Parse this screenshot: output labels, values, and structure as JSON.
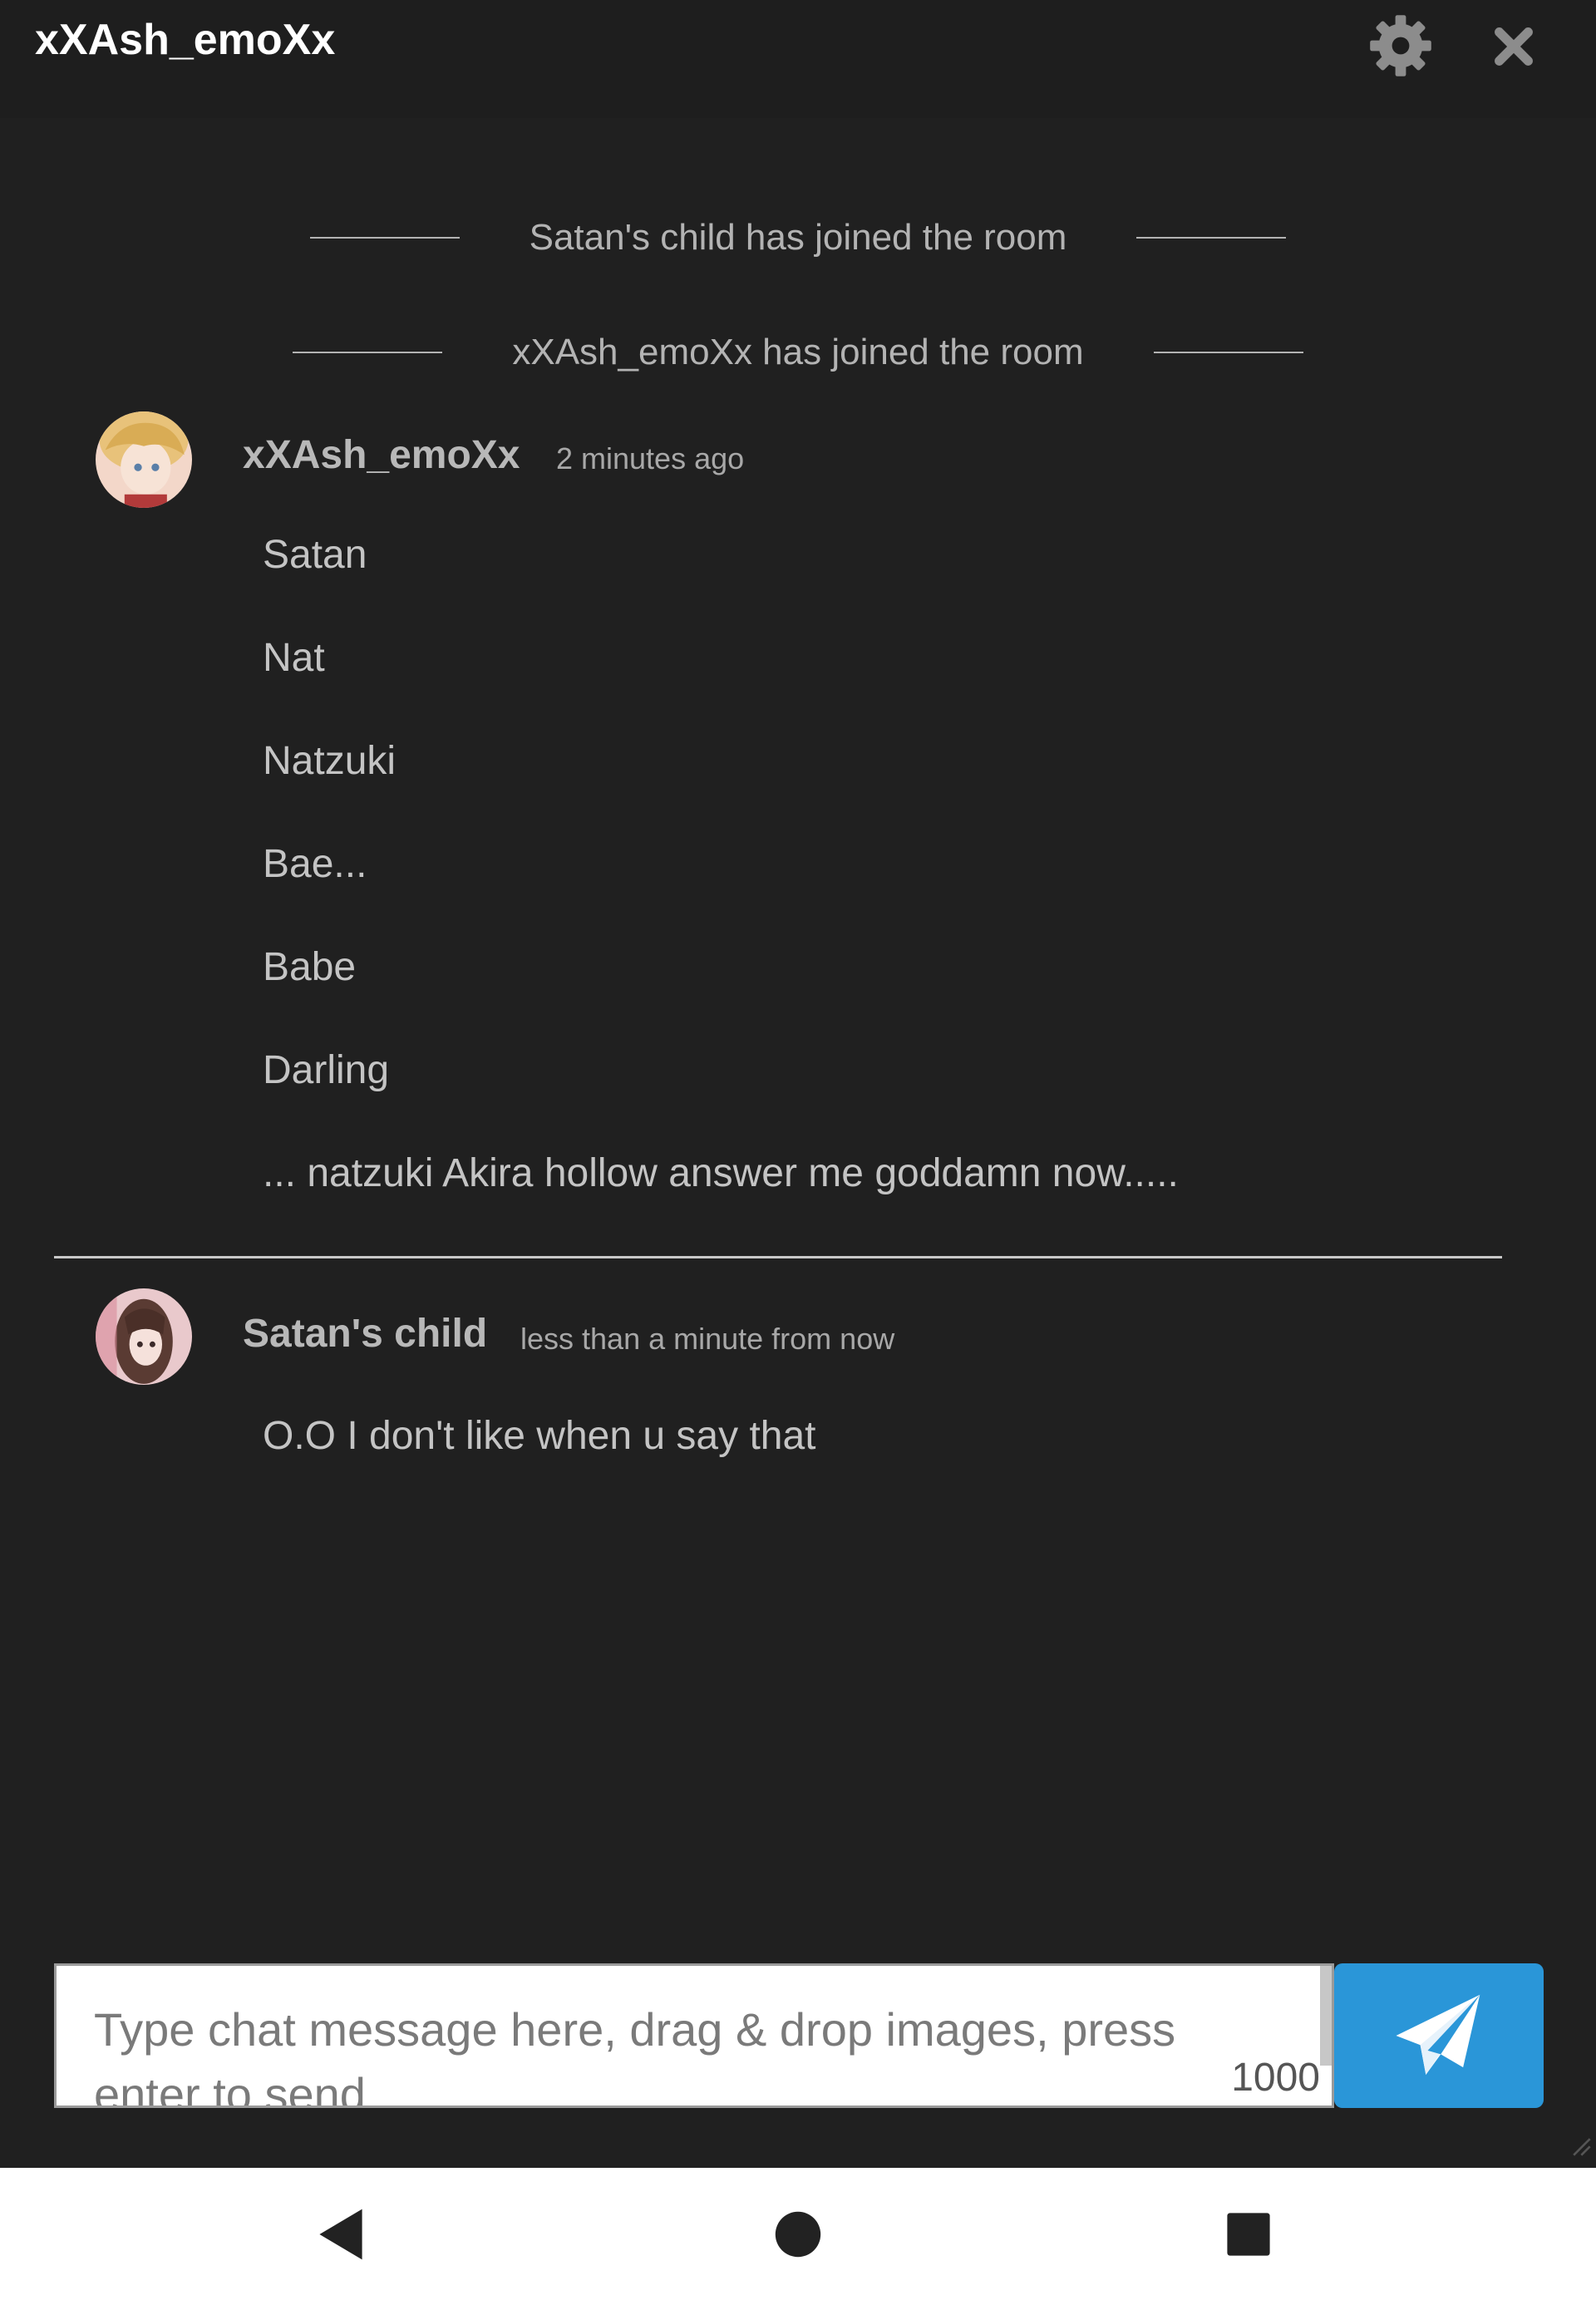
{
  "header": {
    "title": "xXAsh_emoXx",
    "settings_icon": "gear-icon",
    "close_icon": "close-icon"
  },
  "system_messages": [
    {
      "text": "Satan's child has joined the room"
    },
    {
      "text": "xXAsh_emoXx has joined the room"
    }
  ],
  "messages": [
    {
      "author": "xXAsh_emoXx",
      "time": "2 minutes ago",
      "lines": [
        "Satan",
        "Nat",
        "Natzuki",
        "Bae...",
        "Babe",
        "Darling",
        "... natzuki Akira hollow answer me goddamn now....."
      ]
    },
    {
      "author": "Satan's child",
      "time": "less than a minute from now",
      "lines": [
        "O.O I don't like when u say that"
      ]
    }
  ],
  "composer": {
    "placeholder": "Type chat message here, drag & drop images, press enter to send",
    "char_remaining": "1000",
    "send_icon": "paper-plane-icon"
  },
  "navbar": {
    "back_icon": "back-triangle-icon",
    "home_icon": "home-circle-icon",
    "recents_icon": "recents-square-icon"
  },
  "colors": {
    "background": "#202020",
    "header": "#1e1e1e",
    "accent": "#2a96d8"
  }
}
